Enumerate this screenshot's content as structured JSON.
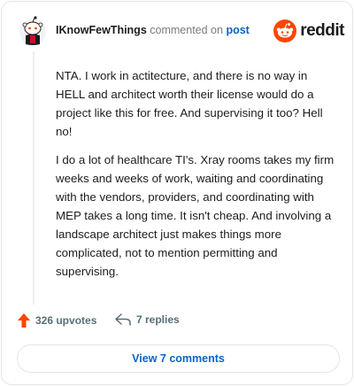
{
  "header": {
    "author": "IKnowFewThings",
    "verb": "commented on",
    "post_link": "post",
    "logo_word": "reddit",
    "avatar_icon": "snoo-avatar-icon",
    "brand_color": "#ff4500"
  },
  "comment": {
    "paragraphs": [
      "NTA. I work in actitecture, and there is no way in HELL and architect worth their license would do a project like this for free. And supervising it too? Hell no!",
      "I do a lot of healthcare TI's. Xray rooms takes my firm weeks and weeks of work, waiting and coordinating with the vendors, providers, and coordinating with MEP takes a long time. It isn't cheap. And involving a landscape architect just makes things more complicated, not to mention permitting and supervising."
    ]
  },
  "actions": {
    "upvotes": "326 upvotes",
    "replies": "7 replies",
    "upvote_icon": "upvote-arrow-icon",
    "reply_icon": "reply-arrow-icon"
  },
  "view_button": {
    "label": "View 7 comments"
  }
}
